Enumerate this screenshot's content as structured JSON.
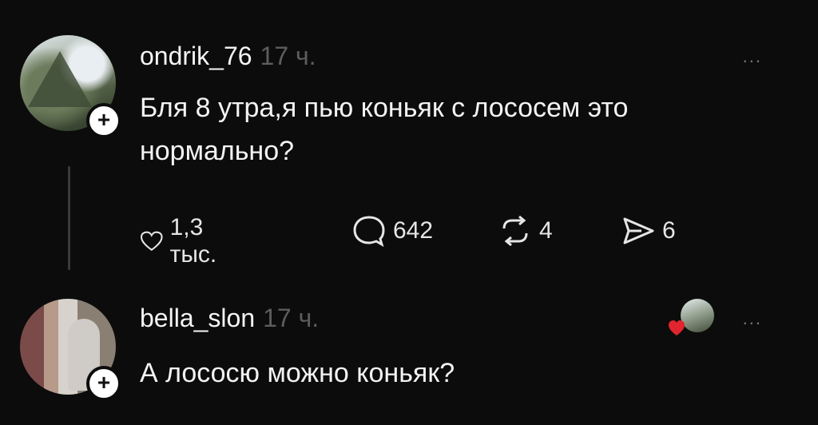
{
  "posts": [
    {
      "username": "ondrik_76",
      "time": "17 ч.",
      "text": "Бля 8 утра,я пью коньяк  с лососем это нормально?",
      "more": "...",
      "stats": {
        "likes": "1,3 тыс.",
        "comments": "642",
        "reposts": "4",
        "shares": "6"
      }
    },
    {
      "username": "bella_slon",
      "time": "17 ч.",
      "text": "А лососю можно коньяк?",
      "more": "..."
    }
  ],
  "follow_symbol": "+",
  "icons": [
    "heart-icon",
    "comment-icon",
    "repost-icon",
    "share-icon",
    "more-icon",
    "plus-icon"
  ],
  "colors": {
    "background": "#0c0c0c",
    "text": "#f2f2f2",
    "muted": "#5d5d5d",
    "heart": "#e0252e"
  }
}
